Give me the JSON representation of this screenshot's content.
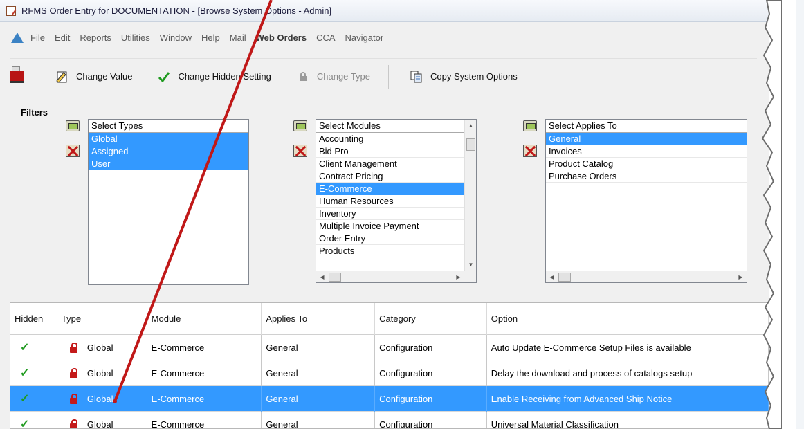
{
  "window": {
    "title": "RFMS Order Entry for DOCUMENTATION - [Browse System Options - Admin]"
  },
  "menubar": {
    "items": [
      {
        "label": "File",
        "bold": false
      },
      {
        "label": "Edit",
        "bold": false
      },
      {
        "label": "Reports",
        "bold": false
      },
      {
        "label": "Utilities",
        "bold": false
      },
      {
        "label": "Window",
        "bold": false
      },
      {
        "label": "Help",
        "bold": false
      },
      {
        "label": "Mail",
        "bold": false
      },
      {
        "label": "Web Orders",
        "bold": true
      },
      {
        "label": "CCA",
        "bold": false
      },
      {
        "label": "Navigator",
        "bold": false
      }
    ]
  },
  "toolbar": {
    "exit_icon": "exit-icon",
    "change_value": "Change Value",
    "change_hidden": "Change Hidden Setting",
    "change_type": "Change Type",
    "copy_options": "Copy System Options"
  },
  "filters": {
    "label": "Filters",
    "types": {
      "header": "Select Types",
      "items": [
        {
          "label": "Global",
          "selected": true
        },
        {
          "label": "Assigned",
          "selected": true
        },
        {
          "label": "User",
          "selected": true
        }
      ]
    },
    "modules": {
      "header": "Select Modules",
      "items": [
        {
          "label": "Accounting",
          "selected": false
        },
        {
          "label": "Bid Pro",
          "selected": false
        },
        {
          "label": "Client Management",
          "selected": false
        },
        {
          "label": "Contract Pricing",
          "selected": false
        },
        {
          "label": "E-Commerce",
          "selected": true
        },
        {
          "label": "Human Resources",
          "selected": false
        },
        {
          "label": "Inventory",
          "selected": false
        },
        {
          "label": "Multiple Invoice Payment",
          "selected": false
        },
        {
          "label": "Order Entry",
          "selected": false
        },
        {
          "label": "Products",
          "selected": false
        }
      ]
    },
    "applies_to": {
      "header": "Select Applies To",
      "items": [
        {
          "label": "General",
          "selected": true
        },
        {
          "label": "Invoices",
          "selected": false
        },
        {
          "label": "Product Catalog",
          "selected": false
        },
        {
          "label": "Purchase Orders",
          "selected": false
        }
      ]
    }
  },
  "grid": {
    "columns": {
      "hidden": "Hidden",
      "type": "Type",
      "module": "Module",
      "applies_to": "Applies To",
      "category": "Category",
      "option": "Option"
    },
    "rows": [
      {
        "hidden": "✓",
        "type": "Global",
        "module": "E-Commerce",
        "applies_to": "General",
        "category": "Configuration",
        "option": "Auto Update E-Commerce Setup Files is available",
        "selected": false
      },
      {
        "hidden": "✓",
        "type": "Global",
        "module": "E-Commerce",
        "applies_to": "General",
        "category": "Configuration",
        "option": "Delay the download and process of catalogs setup",
        "selected": false
      },
      {
        "hidden": "✓",
        "type": "Global",
        "module": "E-Commerce",
        "applies_to": "General",
        "category": "Configuration",
        "option": "Enable Receiving from Advanced Ship Notice",
        "selected": true
      },
      {
        "hidden": "✓",
        "type": "Global",
        "module": "E-Commerce",
        "applies_to": "General",
        "category": "Configuration",
        "option": "Universal Material Classification",
        "selected": false
      }
    ]
  },
  "colors": {
    "selection": "#3399ff",
    "check": "#1f9a1f",
    "lock": "#c41a1a",
    "annotation_arrow": "#c01818"
  }
}
